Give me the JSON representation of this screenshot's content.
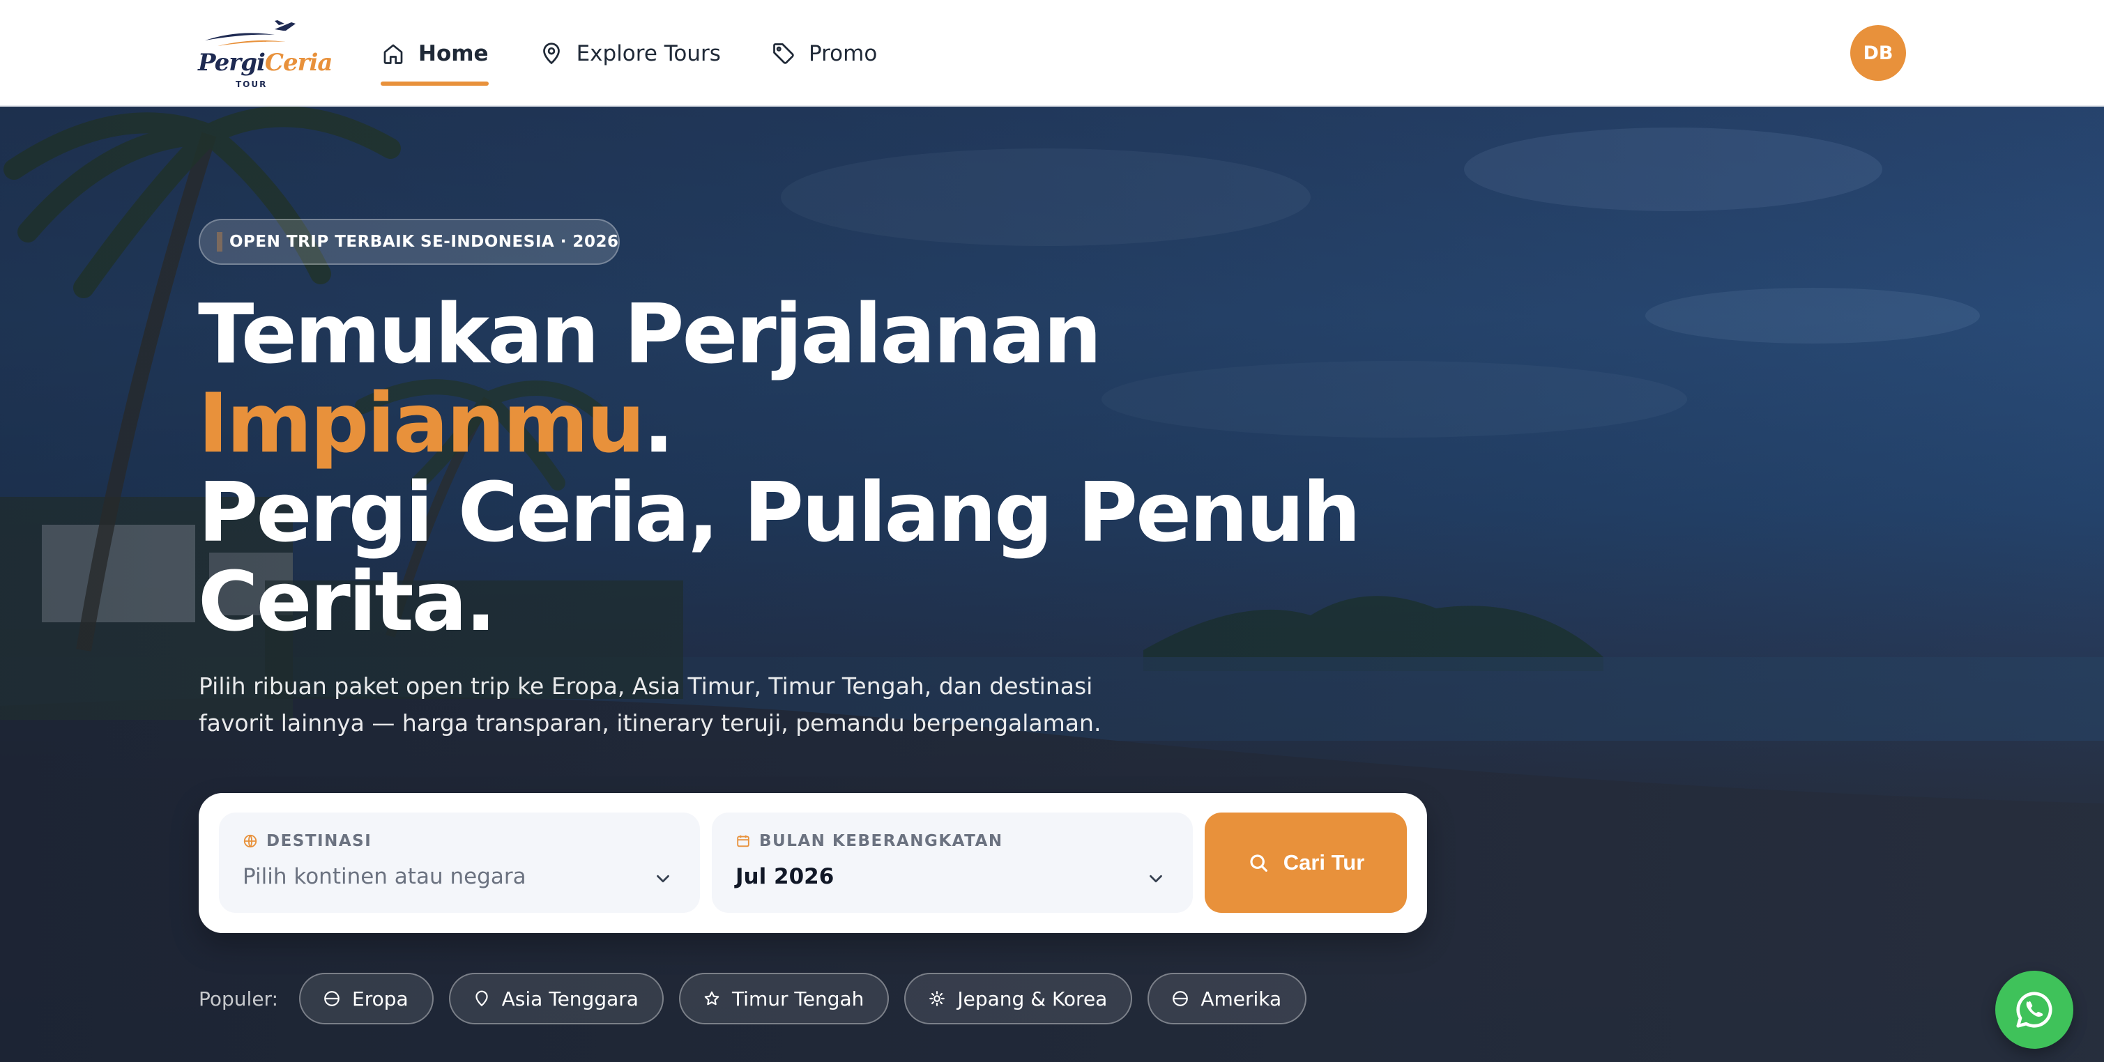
{
  "header": {
    "logo_word_1": "Pergi",
    "logo_word_2": "Ceria",
    "logo_sub": "TOUR",
    "nav": [
      {
        "label": "Home",
        "icon": "home-icon",
        "active": true
      },
      {
        "label": "Explore Tours",
        "icon": "map-pin-icon",
        "active": false
      },
      {
        "label": "Promo",
        "icon": "tag-icon",
        "active": false
      }
    ],
    "avatar_initials": "DB"
  },
  "hero": {
    "badge": "OPEN TRIP TERBAIK SE-INDONESIA · 2026",
    "headline_1": "Temukan Perjalanan",
    "headline_accent": "Impianmu",
    "headline_accent_suffix": ".",
    "headline_3": "Pergi Ceria, Pulang Penuh",
    "headline_4": "Cerita.",
    "subtitle_1": "Pilih ribuan paket open trip ke Eropa, Asia Timur, Timur Tengah, dan destinasi",
    "subtitle_2": "favorit lainnya — harga transparan, itinerary teruji, pemandu berpengalaman."
  },
  "search": {
    "destination_label": "DESTINASI",
    "destination_placeholder": "Pilih kontinen atau negara",
    "month_label": "BULAN KEBERANGKATAN",
    "month_value": "Jul 2026",
    "button_label": "Cari Tur"
  },
  "popular": {
    "label": "Populer:",
    "chips": [
      {
        "label": "Eropa",
        "icon": "globe-icon"
      },
      {
        "label": "Asia Tenggara",
        "icon": "map-pin-icon"
      },
      {
        "label": "Timur Tengah",
        "icon": "star-icon"
      },
      {
        "label": "Jepang & Korea",
        "icon": "sun-icon"
      },
      {
        "label": "Amerika",
        "icon": "globe-icon"
      }
    ]
  },
  "colors": {
    "accent": "#e8913b",
    "navy": "#1e2a52",
    "whatsapp": "#3fc25a"
  }
}
